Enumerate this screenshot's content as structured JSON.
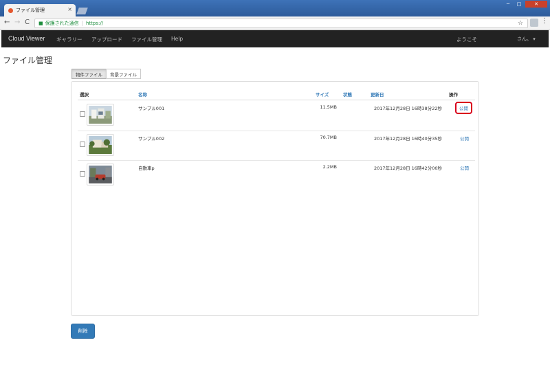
{
  "browser": {
    "tab_title": "ファイル管理",
    "tab_close": "×",
    "secure_label": "保護された通信",
    "separator": "|",
    "url": "https://",
    "window_buttons": {
      "minimize": "─",
      "maximize": "□",
      "close": "✕"
    },
    "nav": {
      "back": "←",
      "forward": "→",
      "reload": "C"
    },
    "star": "☆",
    "menu": "⋮"
  },
  "navbar": {
    "brand": "Cloud Viewer",
    "links": [
      "ギャラリー",
      "アップロード",
      "ファイル管理",
      "Help"
    ],
    "welcome": "ようこそ",
    "user": "さん。 ▾"
  },
  "page": {
    "title": "ファイル管理",
    "file_tabs": [
      "物件ファイル",
      "背景ファイル"
    ],
    "active_tab": "物件ファイル"
  },
  "table": {
    "headers": {
      "select": "選択",
      "name": "名称",
      "size": "サイズ",
      "status": "状態",
      "updated": "更新日",
      "action": "操作"
    },
    "rows": [
      {
        "name": "サンプル001",
        "size": "11.5MB",
        "status": "",
        "updated": "2017年12月28日 16時38分22秒",
        "action": "公開",
        "highlighted": true
      },
      {
        "name": "サンプル002",
        "size": "70.7MB",
        "status": "",
        "updated": "2017年12月28日 16時40分35秒",
        "action": "公開",
        "highlighted": false
      },
      {
        "name": "自動車p",
        "size": "2.2MB",
        "status": "",
        "updated": "2017年12月28日 16時42分00秒",
        "action": "公開",
        "highlighted": false
      }
    ]
  },
  "actions": {
    "delete": "削除"
  },
  "colors": {
    "navbar": "#222222",
    "link": "#337ab7",
    "primary_button": "#337ab7",
    "highlight": "#d9001b"
  }
}
